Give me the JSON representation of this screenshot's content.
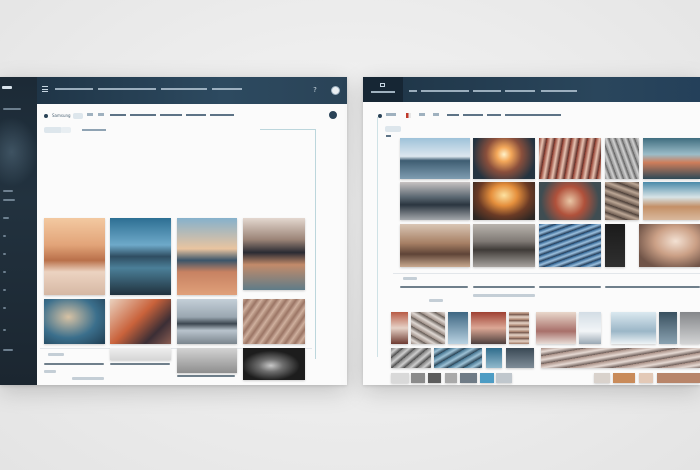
{
  "left_window": {
    "sidebar": {
      "items": [
        "",
        "",
        "",
        "",
        "",
        "",
        "",
        "",
        "",
        "",
        ""
      ]
    },
    "titlebar": {
      "menu_text": "",
      "help_icon_glyph": "?"
    },
    "toolbar": {
      "items": [
        "Samsung",
        "",
        "",
        "",
        "",
        ""
      ]
    }
  },
  "right_window": {
    "titlebar": {
      "menu_text": ""
    },
    "toolbar": {
      "items": [
        "",
        "",
        "",
        "",
        "",
        ""
      ]
    }
  },
  "colors": {
    "chrome_dark": "#1f3547",
    "chrome_mid": "#2d4a60",
    "accent_line": "#bcd6dc",
    "page_bg": "#ececec"
  },
  "icons": [
    "menu-icon",
    "help-icon",
    "account-icon",
    "record-dot-icon",
    "flag-icon"
  ]
}
